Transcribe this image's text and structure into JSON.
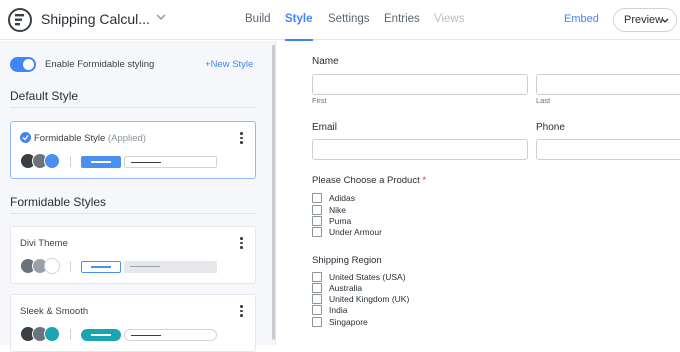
{
  "header": {
    "form_title": "Shipping Calcul...",
    "tabs": [
      "Build",
      "Style",
      "Settings",
      "Entries",
      "Views"
    ],
    "embed_label": "Embed",
    "preview_label": "Preview"
  },
  "sidebar": {
    "toggle_label": "Enable Formidable styling",
    "toggle_on": true,
    "new_style_label": "New Style",
    "default_section_title": "Default Style",
    "default_style": {
      "name": "Formidable Style",
      "status": "(Applied)"
    },
    "formidable_section_title": "Formidable Styles",
    "styles": [
      {
        "name": "Divi Theme"
      },
      {
        "name": "Sleek & Smooth"
      }
    ],
    "colors": {
      "default": [
        "#3a3f45",
        "#6b737b",
        "#4a90f0"
      ],
      "divi": [
        "#6b737b",
        "#9aa1a8",
        "#ffffff"
      ],
      "sleek": [
        "#3a3f45",
        "#6b737b",
        "#1aa3b0"
      ],
      "accent": "#4285f4"
    }
  },
  "form": {
    "name_label": "Name",
    "first_label": "First",
    "last_label": "Last",
    "email_label": "Email",
    "phone_label": "Phone",
    "product_label": "Please Choose a Product",
    "required_mark": "*",
    "products": [
      "Adidas",
      "Nike",
      "Puma",
      "Under Armour"
    ],
    "region_label": "Shipping Region",
    "regions": [
      "United States (USA)",
      "Australia",
      "United Kingdom (UK)",
      "India",
      "Singapore"
    ]
  }
}
